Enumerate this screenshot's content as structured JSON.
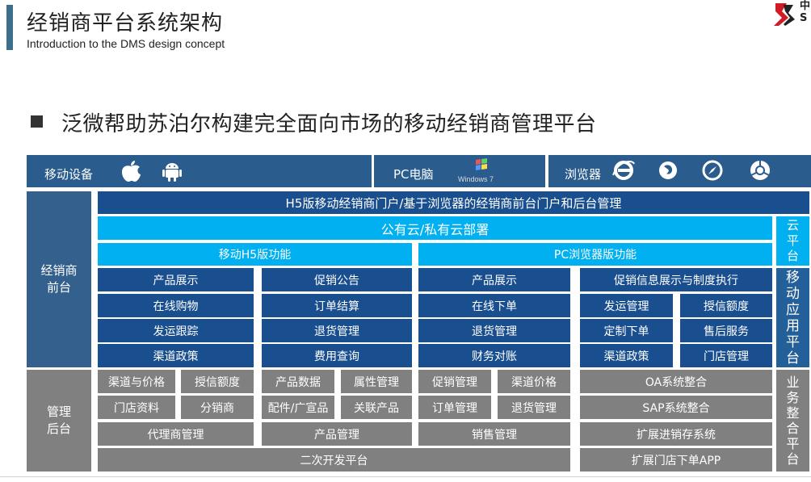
{
  "header": {
    "title": "经销商平台系统架构",
    "subtitle": "Introduction to the DMS  design concept",
    "logo_text": "中\nS"
  },
  "headline": "泛微帮助苏泊尔构建完全面向市场的移动经销商管理平台",
  "top_row": {
    "mobile_label": "移动设备",
    "pc_label": "PC电脑",
    "windows_text": "Windows 7",
    "browser_label": "浏览器"
  },
  "frontend": {
    "side_label_1": "经销商",
    "side_label_2": "前台",
    "portal": "H5版移动经销商门户/基于浏览器的经销商前台门户和后台管理",
    "cloud_deploy": "公有云/私有云部署",
    "mobile_h5": "移动H5版功能",
    "pc_browser": "PC浏览器版功能",
    "cells": [
      "产品展示",
      "促销公告",
      "产品展示",
      "促销信息展示与制度执行",
      "在线购物",
      "订单结算",
      "在线下单",
      "发运管理",
      "授信额度",
      "发运跟踪",
      "退货管理",
      "退货管理",
      "定制下单",
      "售后服务",
      "渠道政策",
      "费用查询",
      "财务对账",
      "渠道政策",
      "门店管理"
    ]
  },
  "right_col": {
    "cloud": [
      "云",
      "平",
      "台"
    ],
    "mobile_app": [
      "移",
      "动",
      "应",
      "用",
      "平",
      "台"
    ],
    "integration": [
      "业",
      "务",
      "整",
      "合",
      "平",
      "台"
    ]
  },
  "backend": {
    "side_label_1": "管理",
    "side_label_2": "后台",
    "cells": [
      "渠道与价格",
      "授信额度",
      "产品数据",
      "属性管理",
      "促销管理",
      "渠道价格",
      "OA系统整合",
      "门店资料",
      "分销商",
      "配件/广宣品",
      "关联产品",
      "订单管理",
      "退货管理",
      "SAP系统整合",
      "代理商管理",
      "产品管理",
      "销售管理",
      "扩展进销存系统",
      "二次开发平台",
      "扩展门店下单APP"
    ]
  },
  "colors": {
    "navy": "#1a4f8f",
    "cyan": "#00b0f0",
    "gray": "#808080",
    "accent": "#3d6e8c"
  },
  "icons": [
    "apple-icon",
    "android-icon",
    "windows-icon",
    "ie-icon",
    "firefox-icon",
    "safari-icon",
    "chrome-icon"
  ]
}
